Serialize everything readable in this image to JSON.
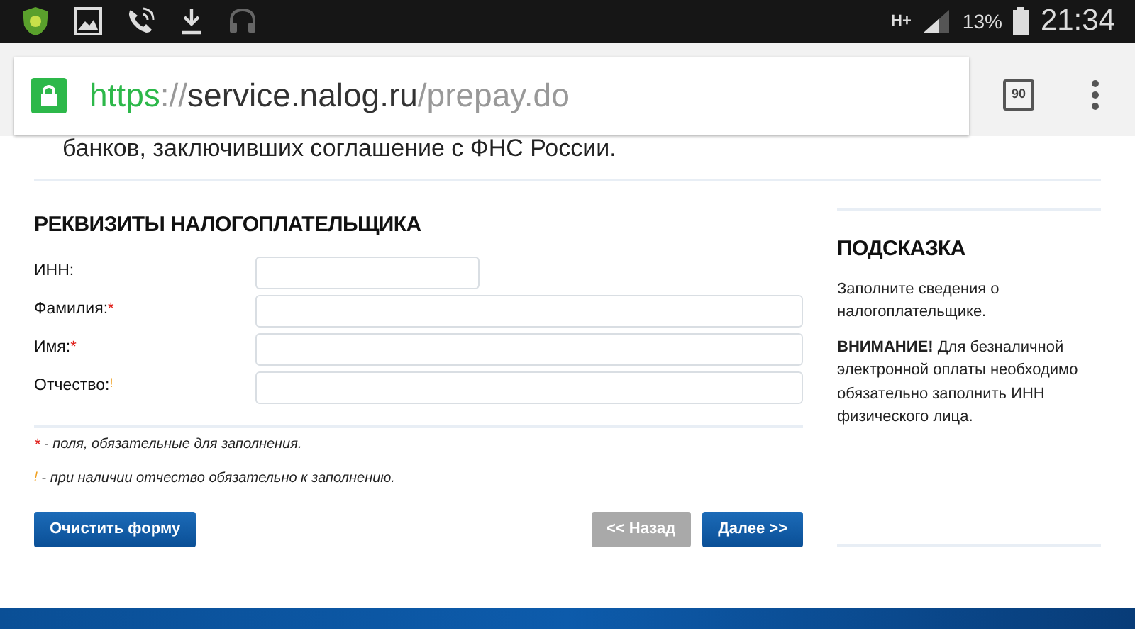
{
  "status_bar": {
    "network": "H+",
    "battery": "13%",
    "time": "21:34"
  },
  "browser": {
    "url_scheme": "https",
    "url_separator": "://",
    "url_host": "service.nalog.ru",
    "url_path": "/prepay.do",
    "tab_count": "90"
  },
  "intro_text": "банков, заключивших соглашение с ФНС России.",
  "form": {
    "title": "РЕКВИЗИТЫ НАЛОГОПЛАТЕЛЬЩИКА",
    "fields": [
      {
        "label": "ИНН:",
        "kind": "short"
      },
      {
        "label": "Фамилия:",
        "marker": "*",
        "kind": "wide"
      },
      {
        "label": "Имя:",
        "marker": "*",
        "kind": "wide"
      },
      {
        "label": "Отчество:",
        "marker": "!",
        "kind": "wide"
      }
    ],
    "notes": [
      {
        "marker": "*",
        "text": "- поля, обязательные для заполнения."
      },
      {
        "marker": "!",
        "text": "- при наличии отчество обязательно к заполнению."
      }
    ],
    "left_buttons": [
      {
        "label": "Очистить форму",
        "disabled": false
      }
    ],
    "right_buttons": [
      {
        "label": "<< Назад",
        "disabled": true
      },
      {
        "label": "Далее >>",
        "disabled": false
      }
    ]
  },
  "hint": {
    "title": "ПОДСКАЗКА",
    "text": "Заполните сведения о налогоплательщике.",
    "warning": "**ВНИМАНИЕ!** Для безналичной электронной оплаты необходимо обязательно заполнить ИНН физического лица."
  }
}
